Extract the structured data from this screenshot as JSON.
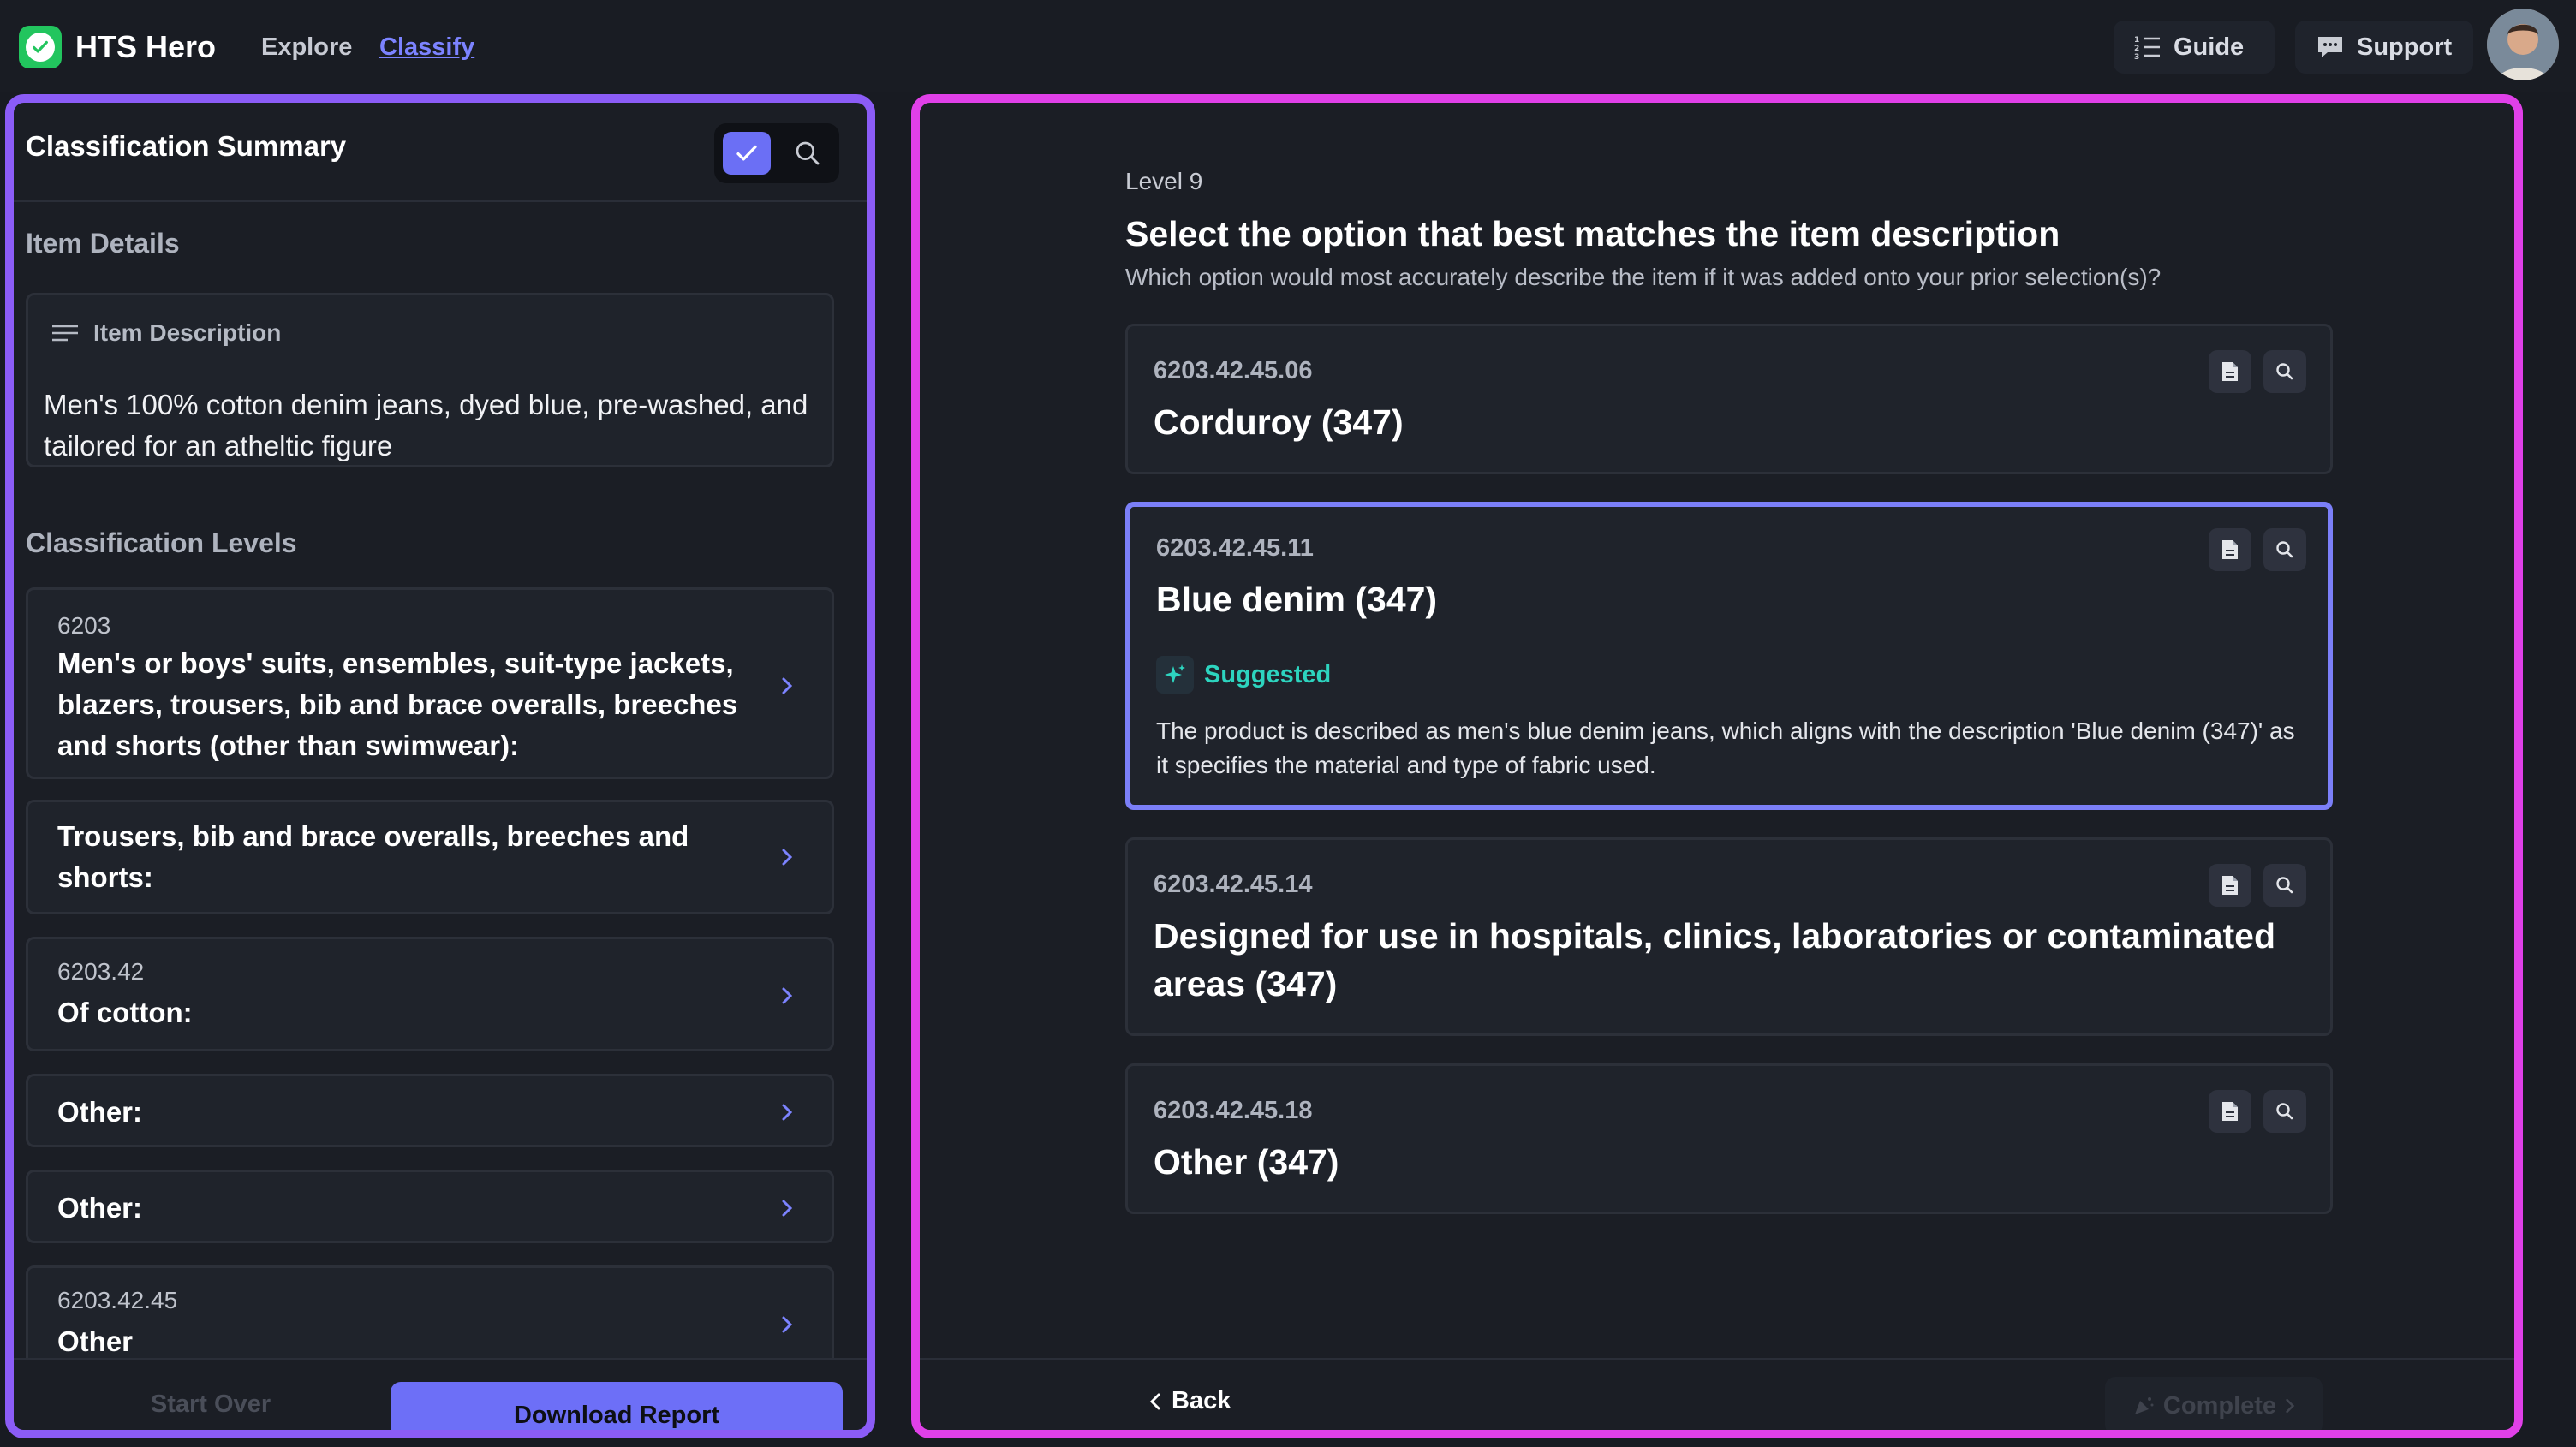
{
  "header": {
    "brand": "HTS Hero",
    "nav": {
      "explore": "Explore",
      "classify": "Classify"
    },
    "guide_label": "Guide",
    "support_label": "Support"
  },
  "summary": {
    "title": "Classification Summary",
    "item_details_label": "Item Details",
    "item_description_label": "Item Description",
    "item_description": "Men's 100% cotton denim jeans, dyed blue, pre-washed, and tailored for an atheltic figure",
    "classification_levels_label": "Classification Levels",
    "levels": [
      {
        "code": "6203",
        "text": "Men's or boys' suits, ensembles, suit-type jackets, blazers, trousers, bib and brace overalls, breeches and shorts (other than swimwear):"
      },
      {
        "code": "",
        "text": "Trousers, bib and brace overalls, breeches and shorts:"
      },
      {
        "code": "6203.42",
        "text": "Of cotton:"
      },
      {
        "code": "",
        "text": "Other:"
      },
      {
        "code": "",
        "text": "Other:"
      },
      {
        "code": "6203.42.45",
        "text": "Other"
      }
    ],
    "start_over_label": "Start Over",
    "download_label": "Download Report"
  },
  "question": {
    "level": "Level 9",
    "title": "Select the option that best matches the item description",
    "subtitle": "Which option would most accurately describe the item if it was added onto your prior selection(s)?",
    "options": [
      {
        "code": "6203.42.45.06",
        "title": "Corduroy (347)"
      },
      {
        "code": "6203.42.45.11",
        "title": "Blue denim (347)",
        "suggested_label": "Suggested",
        "reason": "The product is described as men's blue denim jeans, which aligns with the description 'Blue denim (347)' as it specifies the material and type of fabric used."
      },
      {
        "code": "6203.42.45.14",
        "title": "Designed for use in hospitals, clinics, laboratories or contaminated areas (347)"
      },
      {
        "code": "6203.42.45.18",
        "title": "Other (347)"
      }
    ],
    "back_label": "Back",
    "complete_label": "Complete"
  },
  "colors": {
    "left_border": "#8b5cf6",
    "right_border": "#e040e8",
    "accent": "#6d6ff7",
    "suggested": "#2dd4bf"
  },
  "icons": [
    "check-icon",
    "search-icon",
    "guide-list-icon",
    "chat-icon",
    "lines-icon",
    "chevron-right-icon",
    "document-icon",
    "sparkle-icon",
    "chevron-left-icon",
    "party-icon"
  ]
}
